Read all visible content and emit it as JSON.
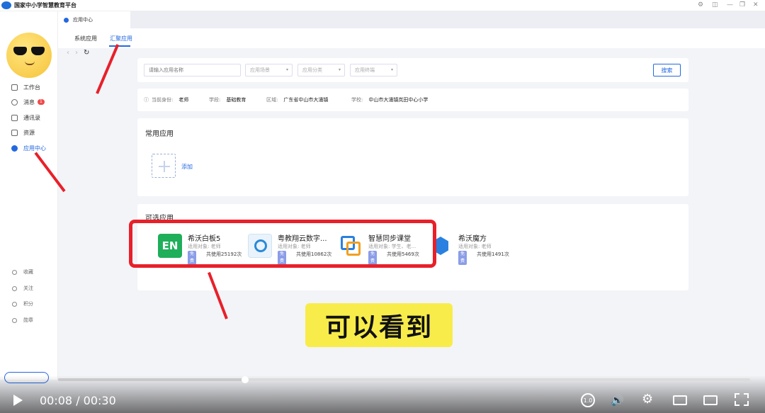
{
  "window": {
    "title": "国家中小学智慧教育平台"
  },
  "sidebar": {
    "items": [
      {
        "label": "工作台"
      },
      {
        "label": "消息",
        "badge": "1"
      },
      {
        "label": "通讯录"
      },
      {
        "label": "资源"
      },
      {
        "label": "应用中心",
        "active": true
      }
    ],
    "bottom_items": [
      {
        "label": "收藏"
      },
      {
        "label": "关注"
      },
      {
        "label": "积分"
      },
      {
        "label": "勋章"
      }
    ]
  },
  "tab": {
    "label": "应用中心"
  },
  "subtabs": [
    {
      "label": "系统应用"
    },
    {
      "label": "汇聚应用",
      "active": true
    }
  ],
  "filters": {
    "search_placeholder": "请输入应用名称",
    "selects": [
      "应用场景",
      "应用分类",
      "应用终端"
    ],
    "search_button": "搜索"
  },
  "info_bar": {
    "identity_label": "当前身份:",
    "identity": "老师",
    "stage_label": "学段:",
    "stage": "基础教育",
    "region_label": "区域:",
    "region": "广东省中山市大涌镇",
    "school_label": "学校:",
    "school": "中山市大涌镇岚田中心小学"
  },
  "common_apps": {
    "title": "常用应用",
    "add_label": "添加"
  },
  "optional_apps": {
    "title": "可选应用",
    "free_label": "免费",
    "items": [
      {
        "name": "希沃白板5",
        "target": "适用对象: 老师",
        "uses": "共使用25192次",
        "icon": "en-whiteboard-icon",
        "color": "#1fae5a"
      },
      {
        "name": "粤教翔云数字...",
        "target": "适用对象: 老师",
        "uses": "共使用10862次",
        "icon": "yuejiao-icon",
        "color": "#2a8ad8"
      },
      {
        "name": "智慧同步课堂",
        "target": "适用对象: 学生、老...",
        "uses": "共使用5469次",
        "icon": "sync-class-icon",
        "color": "#f0a020"
      },
      {
        "name": "希沃魔方",
        "target": "适用对象: 老师",
        "uses": "共使用1491次",
        "icon": "magic-cube-icon",
        "color": "#2a80e0"
      }
    ]
  },
  "caption": "可以看到",
  "player": {
    "time": "00:08 / 00:30",
    "speed": "1.0",
    "progress": 0.27
  }
}
